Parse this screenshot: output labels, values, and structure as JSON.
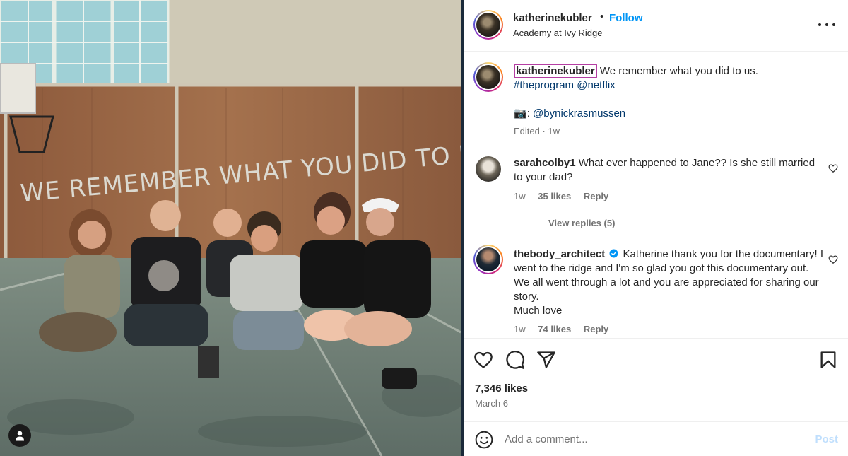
{
  "header": {
    "username": "katherinekubler",
    "separator": "•",
    "follow_label": "Follow",
    "location": "Academy at Ivy Ridge"
  },
  "photo": {
    "wall_text": "WE REMEMBER WHAT YOU DID TO US",
    "user_tag_icon": "person-icon"
  },
  "caption": {
    "username": "katherinekubler",
    "text": "We remember what you did to us.",
    "hashtag": "#theprogram",
    "mention": "@netflix",
    "camera_emoji": "📷",
    "credit_colon": ":",
    "credit": "@bynickrasmussen",
    "meta": "Edited · 1w"
  },
  "comments": [
    {
      "username": "sarahcolby1",
      "text": "What ever happened to Jane?? Is she still married to your dad?",
      "time": "1w",
      "likes": "35 likes",
      "reply_label": "Reply"
    },
    {
      "username": "thebody_architect",
      "verified": true,
      "text": "Katherine thank you for the documentary! I went to the ridge and I'm so glad you got this documentary out. We all went through a lot and you are appreciated for sharing our story.",
      "text2": "Much love",
      "time": "1w",
      "likes": "74 likes",
      "reply_label": "Reply"
    }
  ],
  "view_replies": "View replies (5)",
  "actions": {
    "icons": [
      "heart-icon",
      "comment-icon",
      "share-icon",
      "bookmark-icon"
    ],
    "likes": "7,346 likes",
    "date": "March 6"
  },
  "add_comment": {
    "placeholder": "Add a comment...",
    "post_label": "Post"
  },
  "colors": {
    "link": "#00376b",
    "follow": "#0095f6",
    "post_disabled": "#c0dffd",
    "verified": "#0095f6"
  }
}
